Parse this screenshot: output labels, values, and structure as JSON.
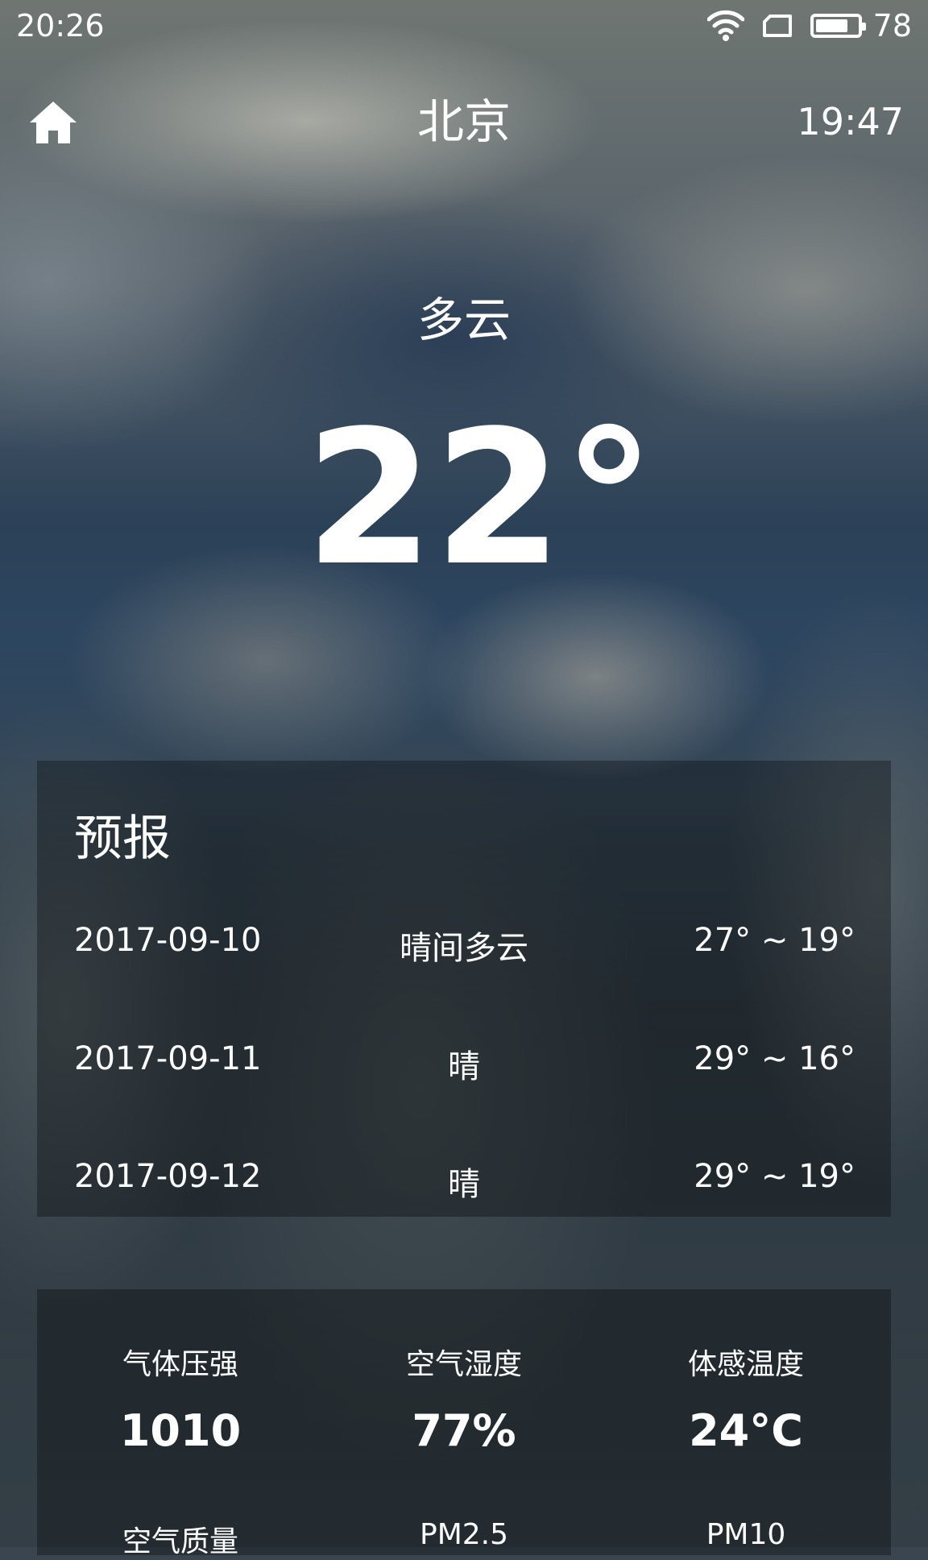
{
  "status_bar": {
    "time": "20:26",
    "battery_level": "78",
    "battery_fraction": 0.78
  },
  "header": {
    "city": "北京",
    "update_time": "19:47"
  },
  "now": {
    "condition": "多云",
    "temperature": "22°"
  },
  "forecast": {
    "title": "预报",
    "days": [
      {
        "date": "2017-09-10",
        "condition": "晴间多云",
        "range": "27° ~ 19°"
      },
      {
        "date": "2017-09-11",
        "condition": "晴",
        "range": "29° ~ 16°"
      },
      {
        "date": "2017-09-12",
        "condition": "晴",
        "range": "29° ~ 19°"
      }
    ]
  },
  "details": [
    {
      "label": "气体压强",
      "value": "1010"
    },
    {
      "label": "空气湿度",
      "value": "77%"
    },
    {
      "label": "体感温度",
      "value": "24°C"
    },
    {
      "label": "空气质量",
      "value": ""
    },
    {
      "label": "PM2.5",
      "value": ""
    },
    {
      "label": "PM10",
      "value": ""
    }
  ]
}
